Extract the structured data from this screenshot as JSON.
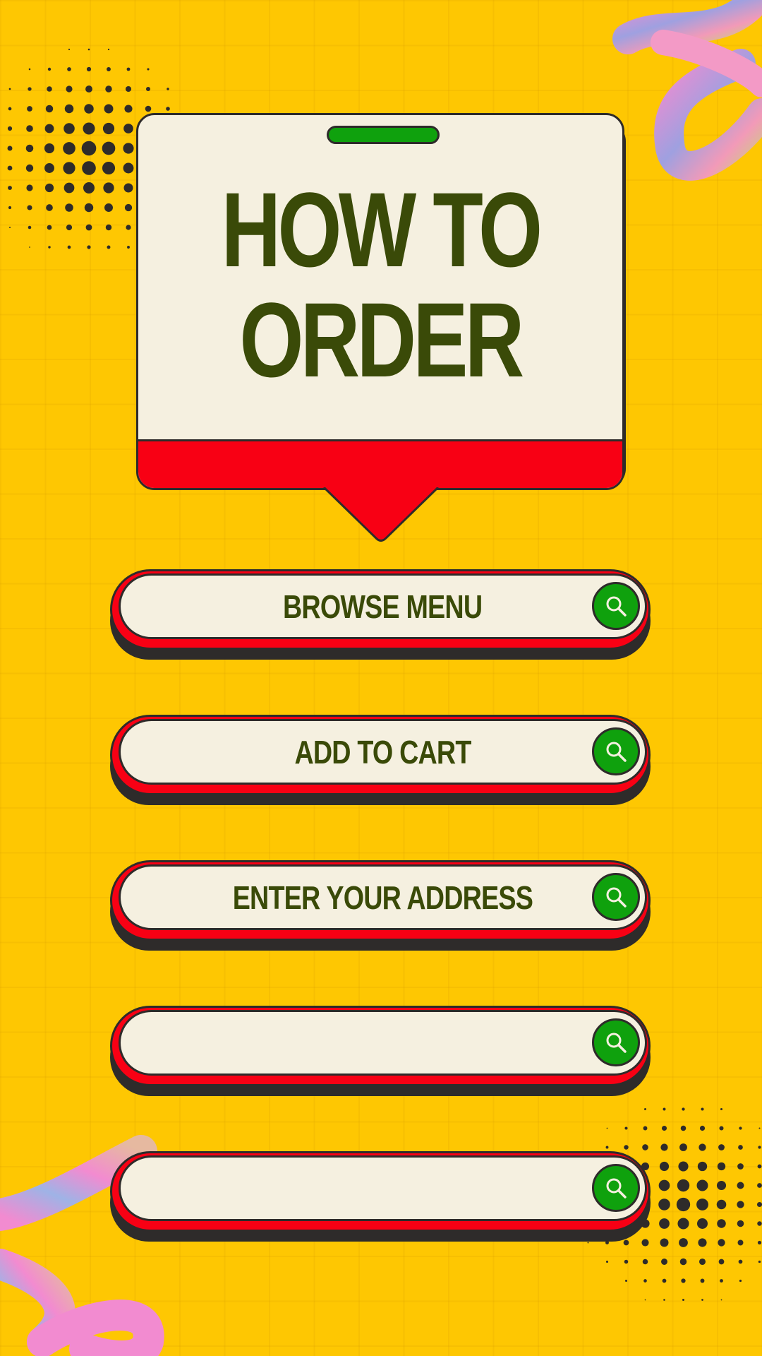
{
  "title": {
    "line1": "HOW TO",
    "line2": "ORDER"
  },
  "steps": [
    {
      "label": "BROWSE MENU",
      "icon": "search-icon"
    },
    {
      "label": "ADD TO CART",
      "icon": "search-icon"
    },
    {
      "label": "ENTER YOUR ADDRESS",
      "icon": "search-icon"
    },
    {
      "label": "",
      "icon": "search-icon"
    },
    {
      "label": "",
      "icon": "search-icon"
    }
  ],
  "colors": {
    "background": "#FEC702",
    "card": "#F5F0E0",
    "accent_red": "#F80014",
    "accent_green": "#0FA10D",
    "text_dark_green": "#3A4A08",
    "outline": "#2E2B2A"
  }
}
